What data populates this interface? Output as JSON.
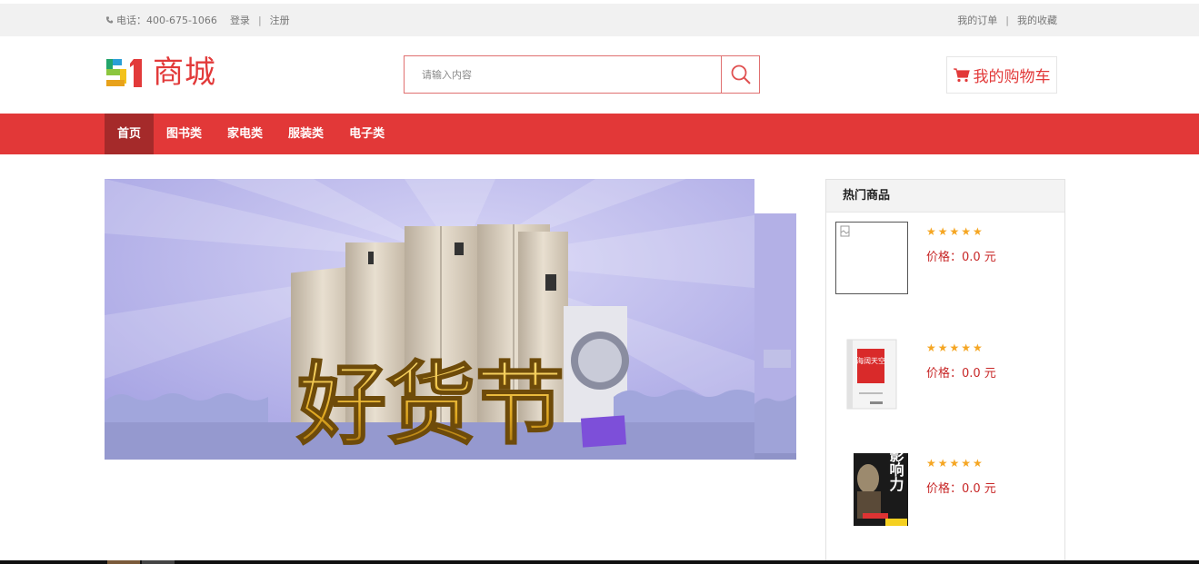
{
  "topbar": {
    "phone_label": "电话：400-675-1066",
    "login": "登录",
    "separator": "|",
    "register": "注册",
    "orders": "我的订单",
    "favorites": "我的收藏"
  },
  "logo": {
    "number": "51",
    "text": "商城"
  },
  "search": {
    "placeholder": "请输入内容",
    "icon": "search-icon"
  },
  "cart": {
    "label": "我的购物车",
    "icon": "cart-icon"
  },
  "nav": {
    "items": [
      {
        "label": "首页",
        "active": true
      },
      {
        "label": "图书类",
        "active": false
      },
      {
        "label": "家电类",
        "active": false
      },
      {
        "label": "服装类",
        "active": false
      },
      {
        "label": "电子类",
        "active": false
      }
    ]
  },
  "banner": {
    "headline": "好货节"
  },
  "hot": {
    "title": "热门商品",
    "items": [
      {
        "stars": "★★★★★",
        "rating": 5,
        "price": "价格：0.0 元",
        "image": "broken-image"
      },
      {
        "stars": "★★★★★",
        "rating": 5,
        "price": "价格：0.0 元",
        "image": "red-book-cover",
        "cover_text": "海阔天空"
      },
      {
        "stars": "★★★★★",
        "rating": 5,
        "price": "价格：0.0 元",
        "image": "influence-book-cover",
        "cover_text": "影响力"
      }
    ]
  },
  "colors": {
    "accent": "#e23838",
    "nav_active": "#a52a2a",
    "star": "#f5a623",
    "price": "#c82828"
  }
}
